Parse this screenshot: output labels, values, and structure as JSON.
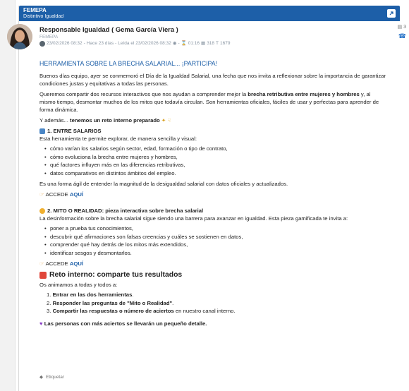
{
  "topbar": {
    "org": "FEMEPA",
    "subtitle": "Distintivo Igualdad"
  },
  "header": {
    "sender": "Responsable Igualdad ( Gema García Viera )",
    "from": "FEMEPA",
    "date": "23/02/2026 08:32",
    "ago": "Hace 23 días",
    "read": "Leída el 23/02/2026 08:32",
    "duration": "01:16",
    "views": "318",
    "size": "1679",
    "right_count": "3"
  },
  "subject": "HERRAMIENTA SOBRE LA BRECHA SALARIAL... ¡PARTICIPA!",
  "paragraphs": {
    "p1": "Buenos días equipo, ayer se conmemoró el Día de la Igualdad Salarial, una fecha que nos invita a reflexionar sobre la importancia de garantizar condiciones justas y equitativas a todas las personas.",
    "p2_a": "Queremos compartir dos recursos interactivos que nos ayudan a comprender mejor la ",
    "p2_b": "brecha retributiva entre mujeres y hombres",
    "p2_c": " y, al mismo tiempo, desmontar muchos de los mitos que todavía circulan. Son herramientas oficiales, fáciles de usar y perfectas para aprender de forma dinámica.",
    "p3_a": "Y además... ",
    "p3_b": "tenemos un reto interno preparado"
  },
  "section1": {
    "title": "1. ENTRE SALARIOS",
    "intro": "Esta herramienta te permite explorar, de manera sencilla y visual:",
    "bullets": [
      "cómo varían los salarios según sector, edad, formación o tipo de contrato,",
      "cómo evoluciona la brecha entre mujeres y hombres,",
      "qué factores influyen más en las diferencias retributivas,",
      "datos comparativos en distintos ámbitos del empleo."
    ],
    "outro": "Es una forma ágil de entender la magnitud de la desigualdad salarial con datos oficiales y actualizados.",
    "cta_text": "ACCEDE",
    "cta_link": "AQUÍ"
  },
  "section2": {
    "title": "2. MITO O REALIDAD: pieza interactiva sobre brecha salarial",
    "intro": "La desinformación sobre la brecha salarial sigue siendo una barrera para avanzar en igualdad. Esta pieza gamificada te invita a:",
    "bullets": [
      "poner a prueba tus conocimientos,",
      "descubrir qué afirmaciones son falsas creencias y cuáles se sostienen en datos,",
      "comprender qué hay detrás de los mitos más extendidos,",
      "identificar sesgos y desmontarlos."
    ],
    "cta_text": "ACCEDE",
    "cta_link": "AQUÍ"
  },
  "reto": {
    "title": "Reto interno: comparte tus resultados",
    "intro": "Os animamos a todas y todos a:",
    "steps": [
      {
        "num": "1.",
        "bold": "Entrar en las dos herramientas",
        "rest": "."
      },
      {
        "num": "2.",
        "bold": "Responder las preguntas de \"Mito o Realidad\"",
        "rest": "."
      },
      {
        "num": "3.",
        "bold": "Compartir las respuestas o número de aciertos",
        "rest": " en nuestro canal interno."
      }
    ],
    "closing": "Las personas con más aciertos se llevarán un pequeño detalle."
  },
  "tags": {
    "label": "Etiquetar"
  },
  "colors": {
    "brand": "#1d5fa8",
    "link": "#1d5fa8"
  }
}
